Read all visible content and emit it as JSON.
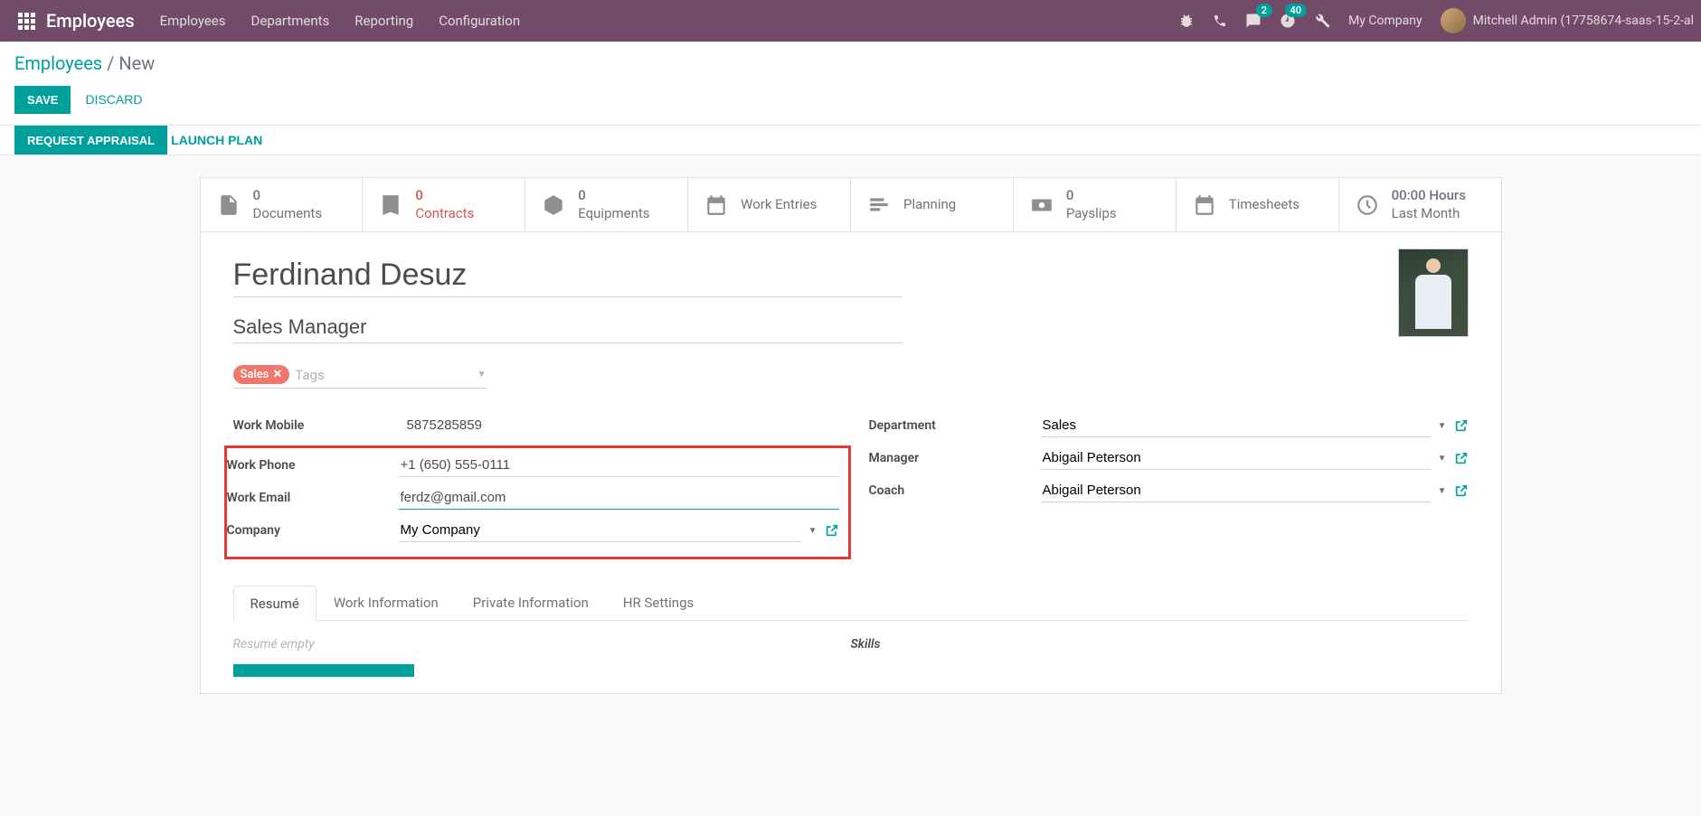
{
  "topbar": {
    "brand": "Employees",
    "menu": [
      "Employees",
      "Departments",
      "Reporting",
      "Configuration"
    ],
    "messages_count": "2",
    "activities_count": "40",
    "company": "My Company",
    "user": "Mitchell Admin (17758674-saas-15-2-al"
  },
  "breadcrumb": {
    "root": "Employees",
    "sep": "/",
    "current": "New"
  },
  "actions": {
    "save": "SAVE",
    "discard": "DISCARD",
    "request_appraisal": "REQUEST APPRAISAL",
    "launch_plan": "LAUNCH PLAN"
  },
  "stats": [
    {
      "count": "0",
      "label": "Documents"
    },
    {
      "count": "0",
      "label": "Contracts",
      "warn": true
    },
    {
      "count": "0",
      "label": "Equipments"
    },
    {
      "count": "",
      "label": "Work Entries"
    },
    {
      "count": "",
      "label": "Planning"
    },
    {
      "count": "0",
      "label": "Payslips"
    },
    {
      "count": "",
      "label": "Timesheets"
    },
    {
      "count": "00:00 Hours",
      "label": "Last Month"
    }
  ],
  "form": {
    "name": "Ferdinand Desuz",
    "job_title": "Sales Manager",
    "tag": "Sales",
    "tags_placeholder": "Tags",
    "left": {
      "work_mobile_label": "Work Mobile",
      "work_mobile": "5875285859",
      "work_phone_label": "Work Phone",
      "work_phone": "+1 (650) 555-0111",
      "work_email_label": "Work Email",
      "work_email": "ferdz@gmail.com",
      "company_label": "Company",
      "company": "My Company"
    },
    "right": {
      "department_label": "Department",
      "department": "Sales",
      "manager_label": "Manager",
      "manager": "Abigail Peterson",
      "coach_label": "Coach",
      "coach": "Abigail Peterson"
    }
  },
  "tabs": [
    "Resumé",
    "Work Information",
    "Private Information",
    "HR Settings"
  ],
  "resume": {
    "empty": "Resumé empty",
    "skills_header": "Skills"
  }
}
